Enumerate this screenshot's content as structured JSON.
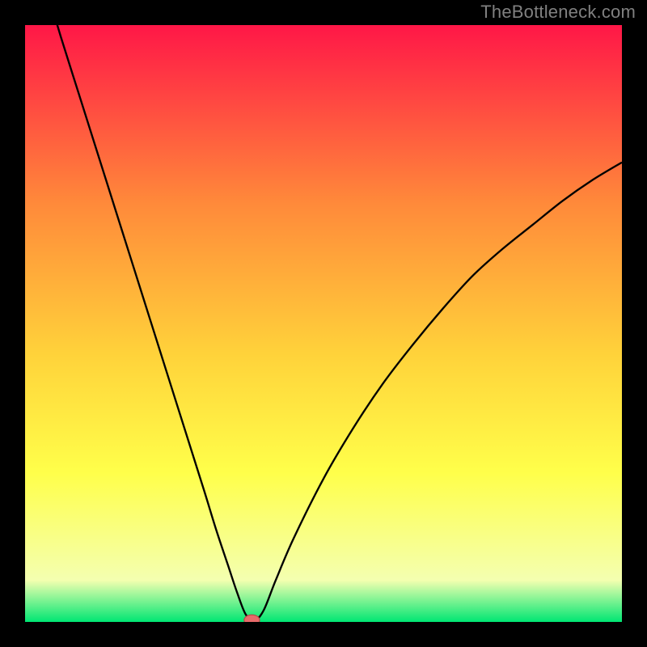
{
  "watermark": "TheBottleneck.com",
  "colors": {
    "bg": "#000000",
    "grad_top": "#ff1747",
    "grad_mid1": "#ff8a3a",
    "grad_mid2": "#ffd23a",
    "grad_mid3": "#ffff4a",
    "grad_mid4": "#f4ffb0",
    "grad_bottom": "#00e673",
    "curve": "#000000",
    "marker_fill": "#e86a6a",
    "marker_stroke": "#b94545"
  },
  "chart_data": {
    "type": "line",
    "title": "",
    "xlabel": "",
    "ylabel": "",
    "xlim": [
      0,
      100
    ],
    "ylim": [
      0,
      100
    ],
    "series": [
      {
        "name": "bottleneck-curve",
        "x": [
          0,
          3,
          6,
          9,
          12,
          15,
          18,
          21,
          24,
          27,
          30,
          32,
          34,
          35.5,
          37,
          38.5,
          40,
          42,
          45,
          50,
          55,
          60,
          65,
          70,
          75,
          80,
          85,
          90,
          95,
          100
        ],
        "y": [
          118,
          108,
          98,
          88.5,
          79,
          69.5,
          60,
          50.5,
          41,
          31.5,
          22,
          15.5,
          9.5,
          5,
          1.2,
          0.3,
          2,
          7,
          14,
          24,
          32.5,
          40,
          46.5,
          52.5,
          58,
          62.5,
          66.5,
          70.5,
          74,
          77
        ]
      }
    ],
    "marker": {
      "x": 38,
      "y": 0.3
    }
  }
}
